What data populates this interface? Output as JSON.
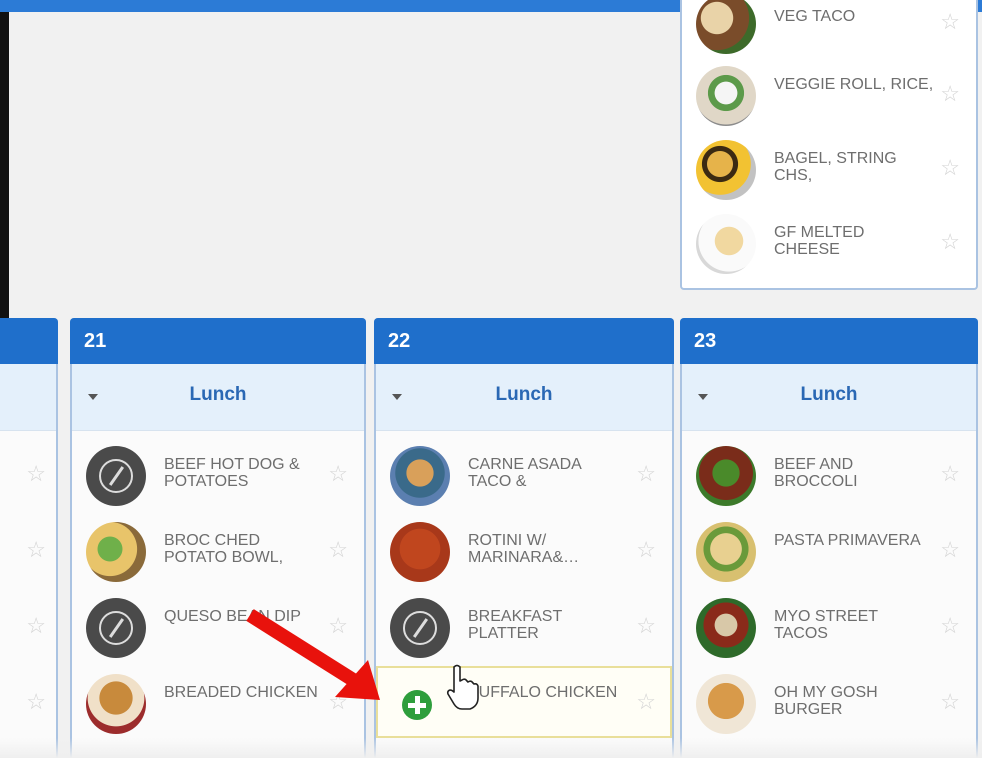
{
  "page": {
    "title": ""
  },
  "top_card": {
    "items": [
      {
        "name": "VEG TACO",
        "thumb": "taco"
      },
      {
        "name": "VEGGIE ROLL, RICE,",
        "thumb": "roll"
      },
      {
        "name": "BAGEL, STRING CHS,",
        "thumb": "bagel"
      },
      {
        "name": "GF MELTED CHEESE",
        "thumb": "cheese"
      }
    ]
  },
  "columns": [
    {
      "day": "",
      "meal": "",
      "items": [
        {
          "name": ""
        },
        {
          "name": ""
        },
        {
          "name": ""
        },
        {
          "name": ""
        }
      ]
    },
    {
      "day": "21",
      "meal": "Lunch",
      "items": [
        {
          "name": "BEEF HOT DOG & POTATOES",
          "thumb": "placeholder"
        },
        {
          "name": "BROC CHED POTATO BOWL,",
          "thumb": "broc"
        },
        {
          "name": "QUESO BEAN DIP",
          "thumb": "placeholder"
        },
        {
          "name": "BREADED CHICKEN",
          "thumb": "chicken"
        }
      ]
    },
    {
      "day": "22",
      "meal": "Lunch",
      "items": [
        {
          "name": "CARNE ASADA TACO &",
          "thumb": "carne"
        },
        {
          "name": "ROTINI W/ MARINARA&…",
          "thumb": "rotini"
        },
        {
          "name": "BREAKFAST PLATTER",
          "thumb": "placeholder"
        },
        {
          "name": "BUFFALO CHICKEN",
          "thumb": "add",
          "hovered": true
        }
      ]
    },
    {
      "day": "23",
      "meal": "Lunch",
      "items": [
        {
          "name": "BEEF AND BROCCOLI",
          "thumb": "beef"
        },
        {
          "name": "PASTA PRIMAVERA",
          "thumb": "pasta"
        },
        {
          "name": "MYO STREET TACOS",
          "thumb": "street"
        },
        {
          "name": "OH MY GOSH BURGER",
          "thumb": "burger"
        }
      ]
    }
  ],
  "icons": {
    "star": "star-outline-icon",
    "caret": "caret-down-icon",
    "add": "plus-circle-icon",
    "cursor": "hand-pointer-icon",
    "arrow": "red-arrow-annotation"
  },
  "colors": {
    "header_blue": "#1f6fcb",
    "meal_bar": "#e4f0fb",
    "add_green": "#2e9e3c",
    "arrow_red": "#e8120c"
  }
}
